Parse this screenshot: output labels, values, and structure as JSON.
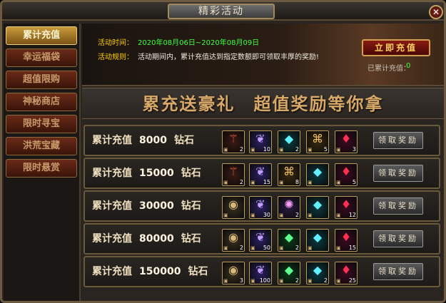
{
  "window": {
    "title": "精彩活动",
    "close_glyph": "✕"
  },
  "sidebar": {
    "items": [
      {
        "label": "累计充值",
        "active": true
      },
      {
        "label": "幸运福袋",
        "active": false
      },
      {
        "label": "超值限购",
        "active": false
      },
      {
        "label": "神秘商店",
        "active": false
      },
      {
        "label": "限时寻宝",
        "active": false
      },
      {
        "label": "洪荒宝藏",
        "active": false
      },
      {
        "label": "限时悬赏",
        "active": false
      }
    ]
  },
  "banner": {
    "time_label": "活动时间：",
    "time_value": "2020年08月06日~2020年08月09日",
    "rule_label": "活动规则：",
    "rule_value": "活动期间内，累计充值达到指定数额即可领取丰厚的奖励!",
    "recharge_button": "立即充值",
    "cumulative_label": "已累计充值：",
    "cumulative_value": "0"
  },
  "slogan": "累充送豪礼　超值奖励等你拿",
  "tiers": [
    {
      "label": "累计充值",
      "amount": "8000",
      "unit": "钻石",
      "claim": "领取奖励",
      "items": [
        {
          "icon": "staff-icon",
          "count": "2"
        },
        {
          "icon": "feather-icon",
          "count": "10"
        },
        {
          "icon": "crystal-icon",
          "count": "2"
        },
        {
          "icon": "scroll-icon",
          "count": "5"
        },
        {
          "icon": "ruby-amulet-icon",
          "count": "3"
        }
      ]
    },
    {
      "label": "累计充值",
      "amount": "15000",
      "unit": "钻石",
      "claim": "领取奖励",
      "items": [
        {
          "icon": "staff-icon",
          "count": "2"
        },
        {
          "icon": "feather-icon",
          "count": "15"
        },
        {
          "icon": "scroll-icon",
          "count": "8"
        },
        {
          "icon": "crystal-icon",
          "count": ""
        },
        {
          "icon": "ruby-amulet-icon",
          "count": "5"
        }
      ]
    },
    {
      "label": "累计充值",
      "amount": "30000",
      "unit": "钻石",
      "claim": "领取奖励",
      "items": [
        {
          "icon": "shield-icon",
          "count": ""
        },
        {
          "icon": "feather-icon",
          "count": "30"
        },
        {
          "icon": "rainbow-gem-icon",
          "count": "2"
        },
        {
          "icon": "crystal-icon",
          "count": ""
        },
        {
          "icon": "ruby-amulet-icon",
          "count": "12"
        }
      ]
    },
    {
      "label": "累计充值",
      "amount": "80000",
      "unit": "钻石",
      "claim": "领取奖励",
      "items": [
        {
          "icon": "shield-icon",
          "count": "2"
        },
        {
          "icon": "feather-icon",
          "count": "50"
        },
        {
          "icon": "green-gem-icon",
          "count": "2"
        },
        {
          "icon": "crystal-icon",
          "count": ""
        },
        {
          "icon": "ruby-amulet-icon",
          "count": "15"
        }
      ]
    },
    {
      "label": "累计充值",
      "amount": "150000",
      "unit": "钻石",
      "claim": "领取奖励",
      "items": [
        {
          "icon": "shield-icon",
          "count": "3"
        },
        {
          "icon": "feather-icon",
          "count": "100"
        },
        {
          "icon": "green-gem-icon",
          "count": "2"
        },
        {
          "icon": "crystal-icon",
          "count": "2"
        },
        {
          "icon": "ruby-amulet-icon",
          "count": "25"
        }
      ]
    }
  ],
  "colors": {
    "gold": "#ffcc00",
    "date_green": "#40ff40",
    "accent_red": "#8a1a10"
  }
}
